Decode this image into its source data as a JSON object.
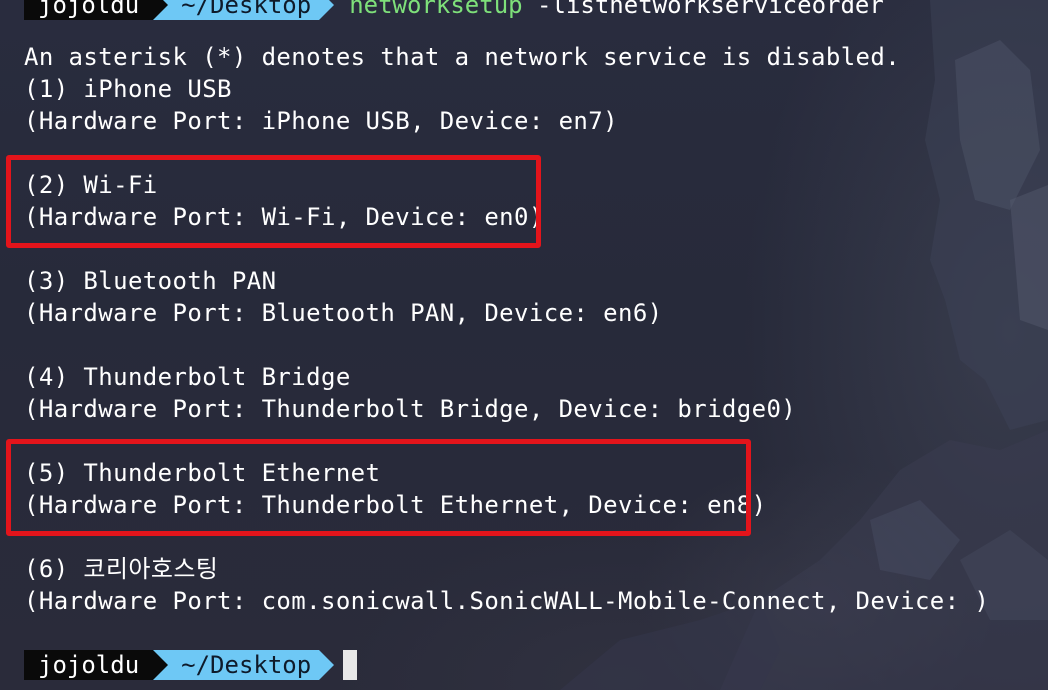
{
  "prompt": {
    "user": "jojoldu",
    "cwd": "~/Desktop",
    "command": "networksetup",
    "args": " -listnetworkserviceorder"
  },
  "output": {
    "header": "An asterisk (*) denotes that a network service is disabled.",
    "services": [
      {
        "name": "(1) iPhone USB",
        "detail": "(Hardware Port: iPhone USB, Device: en7)"
      },
      {
        "name": "(2) Wi-Fi",
        "detail": "(Hardware Port: Wi-Fi, Device: en0)",
        "highlighted": true
      },
      {
        "name": "(3) Bluetooth PAN",
        "detail": "(Hardware Port: Bluetooth PAN, Device: en6)"
      },
      {
        "name": "(4) Thunderbolt Bridge",
        "detail": "(Hardware Port: Thunderbolt Bridge, Device: bridge0)"
      },
      {
        "name": "(5) Thunderbolt Ethernet",
        "detail": "(Hardware Port: Thunderbolt Ethernet, Device: en8)",
        "highlighted": true
      },
      {
        "name": "(6) 코리아호스팅",
        "detail": "(Hardware Port: com.sonicwall.SonicWALL-Mobile-Connect, Device: )"
      }
    ]
  },
  "next_prompt": {
    "user": "jojoldu",
    "cwd": "~/Desktop"
  },
  "colors": {
    "background": "#272a3a",
    "highlight_box": "#e3141b",
    "prompt_dir_bg": "#6ec8f5",
    "prompt_user_bg": "#0a0a0a",
    "command_text": "#7ee07a"
  }
}
